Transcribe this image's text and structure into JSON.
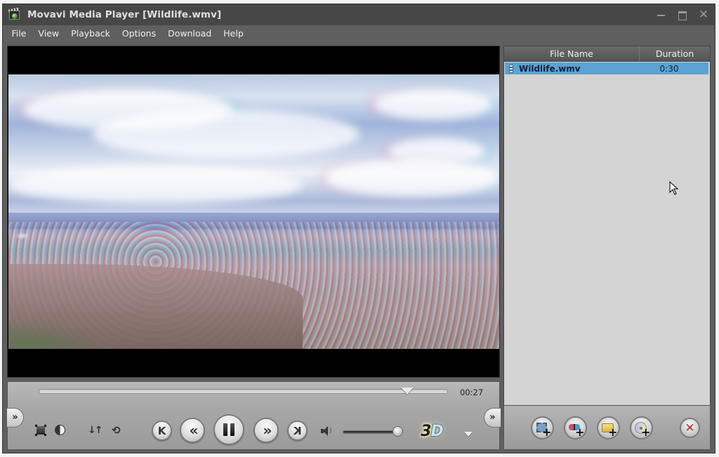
{
  "window": {
    "title": "Movavi Media Player [Wildlife.wmv]",
    "app_icon": "movavi-app-icon",
    "controls": {
      "minimize_icon": "minimize-icon",
      "maximize_icon": "maximize-icon",
      "close_glyph": "✕"
    }
  },
  "menu": {
    "items": [
      {
        "label": "File"
      },
      {
        "label": "View"
      },
      {
        "label": "Playback"
      },
      {
        "label": "Options"
      },
      {
        "label": "Download"
      },
      {
        "label": "Help"
      }
    ]
  },
  "video": {
    "file": "Wildlife.wmv",
    "content": "anaglyph 3D footage of a gannet colony on a cliff top with sea and cloudy sky"
  },
  "playback": {
    "elapsed_label": "00:27",
    "progress_fraction": 0.9,
    "volume_fraction": 1.0,
    "state": "playing",
    "buttons": {
      "prev_glyph": "K",
      "rewind_glyph": "«",
      "forward_glyph": "»",
      "next_glyph": "K",
      "expand_left_glyph": "»",
      "expand_right_glyph": "»",
      "mode_3d_label_a": "3",
      "mode_3d_label_b": "D",
      "sort_glyph": "↓↑",
      "rotate_glyph": "⟲"
    }
  },
  "playlist": {
    "columns": [
      {
        "label": "File Name"
      },
      {
        "label": "Duration"
      }
    ],
    "rows": [
      {
        "name": "Wildlife.wmv",
        "duration": "0:30",
        "selected": true
      }
    ],
    "buttons": {
      "add_video": "add-video-icon",
      "add_3d": "add-3d-video-icon",
      "add_folder": "add-folder-icon",
      "add_disc": "add-disc-icon",
      "remove_glyph": "✕",
      "plus_glyph": "+"
    }
  },
  "colors": {
    "titlebar": "#474747",
    "window_bg": "#5f5f5f",
    "playlist_bg": "#d4d4d4",
    "selection": "#5aa3d6",
    "remove_red": "#c0262a"
  }
}
